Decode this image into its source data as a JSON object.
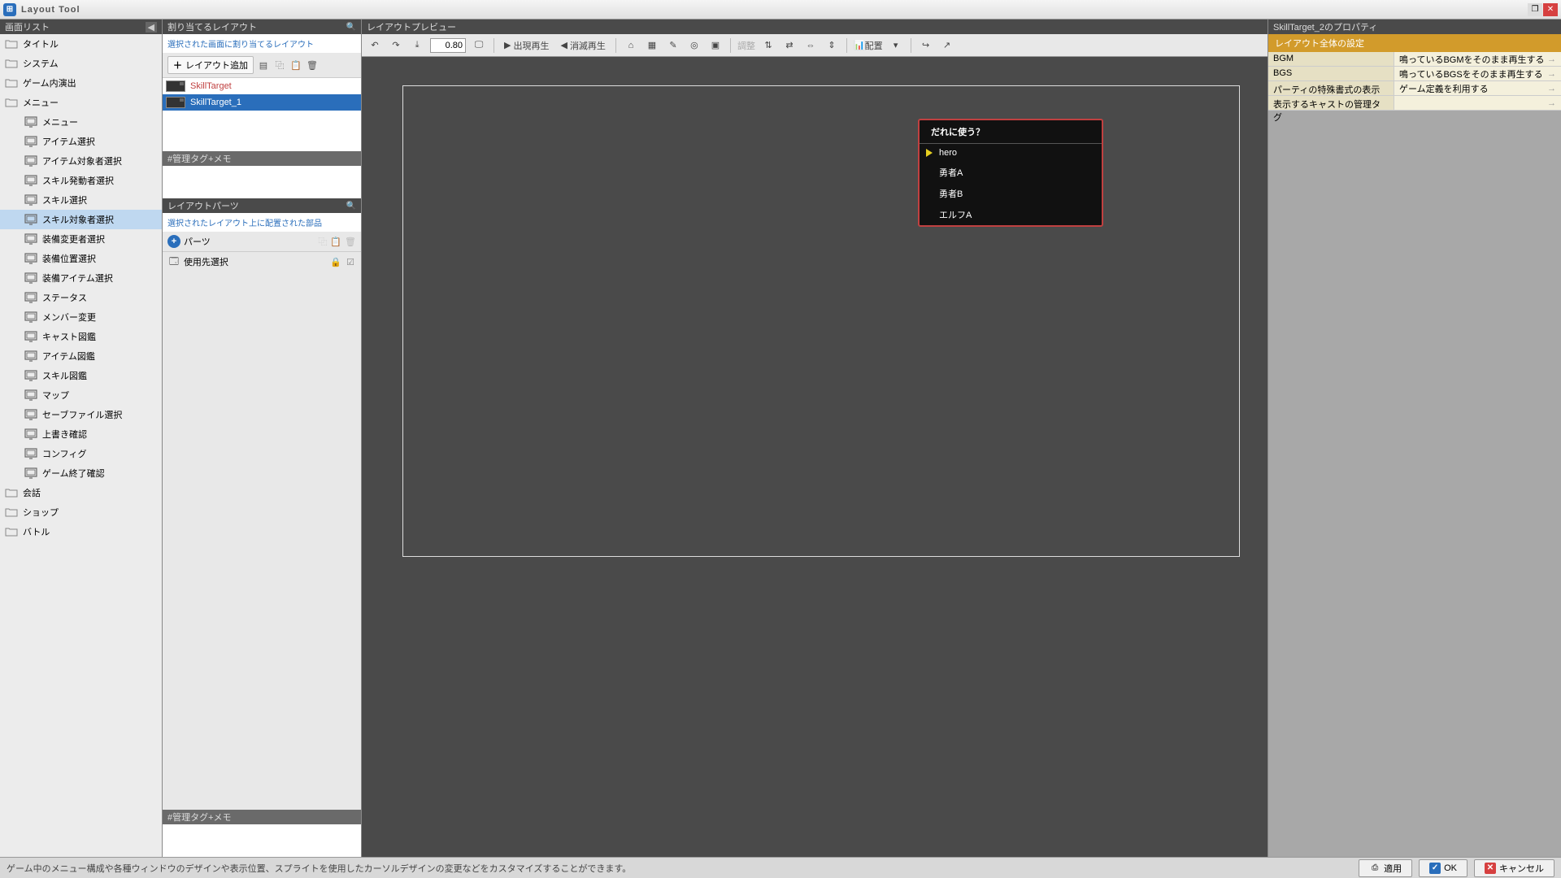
{
  "titlebar": {
    "title": "Layout Tool"
  },
  "leftPanel": {
    "header": "画面リスト"
  },
  "screenTree": [
    {
      "type": "folder",
      "label": "タイトル"
    },
    {
      "type": "folder",
      "label": "システム"
    },
    {
      "type": "folder",
      "label": "ゲーム内演出"
    },
    {
      "type": "folder",
      "label": "メニュー"
    },
    {
      "type": "screen",
      "label": "メニュー"
    },
    {
      "type": "screen",
      "label": "アイテム選択"
    },
    {
      "type": "screen",
      "label": "アイテム対象者選択"
    },
    {
      "type": "screen",
      "label": "スキル発動者選択"
    },
    {
      "type": "screen",
      "label": "スキル選択"
    },
    {
      "type": "screen",
      "label": "スキル対象者選択",
      "selected": true
    },
    {
      "type": "screen",
      "label": "装備変更者選択"
    },
    {
      "type": "screen",
      "label": "装備位置選択"
    },
    {
      "type": "screen",
      "label": "装備アイテム選択"
    },
    {
      "type": "screen",
      "label": "ステータス"
    },
    {
      "type": "screen",
      "label": "メンバー変更"
    },
    {
      "type": "screen",
      "label": "キャスト図鑑"
    },
    {
      "type": "screen",
      "label": "アイテム図鑑"
    },
    {
      "type": "screen",
      "label": "スキル図鑑"
    },
    {
      "type": "screen",
      "label": "マップ"
    },
    {
      "type": "screen",
      "label": "セーブファイル選択"
    },
    {
      "type": "screen",
      "label": "上書き確認"
    },
    {
      "type": "screen",
      "label": "コンフィグ"
    },
    {
      "type": "screen",
      "label": "ゲーム終了確認"
    },
    {
      "type": "folder",
      "label": "会話"
    },
    {
      "type": "folder",
      "label": "ショップ"
    },
    {
      "type": "folder",
      "label": "バトル"
    }
  ],
  "midPanel": {
    "assignHeader": "割り当てるレイアウト",
    "assignHint": "選択された画面に割り当てるレイアウト",
    "addLayoutLabel": "レイアウト追加",
    "layouts": [
      {
        "name": "SkillTarget",
        "selected": false
      },
      {
        "name": "SkillTarget_1",
        "selected": true
      }
    ],
    "memoHeader1": "#管理タグ+メモ",
    "partsHeader": "レイアウトパーツ",
    "partsHint": "選択されたレイアウト上に配置された部品",
    "partsLabel": "パーツ",
    "usageLabel": "使用先選択",
    "memoHeader2": "#管理タグ+メモ"
  },
  "preview": {
    "header": "レイアウトプレビュー",
    "zoom": "0.80",
    "playAppear": "出現再生",
    "playDisappear": "消滅再生",
    "adjustLabel": "調整",
    "arrangeLabel": "配置",
    "gameWindow": {
      "title": "だれに使う？",
      "items": [
        "hero",
        "勇者A",
        "勇者B",
        "エルフA"
      ]
    }
  },
  "rightPanel": {
    "header": "SkillTarget_2のプロパティ",
    "section": "レイアウト全体の設定",
    "rows": [
      {
        "key": "BGM",
        "val": "鳴っているBGMをそのまま再生する",
        "arrow": true
      },
      {
        "key": "BGS",
        "val": "鳴っているBGSをそのまま再生する",
        "arrow": true
      },
      {
        "key": "パーティの特殊書式の表示",
        "val": "ゲーム定義を利用する",
        "arrow": true
      },
      {
        "key": "表示するキャストの管理タグ",
        "val": "",
        "arrow": true
      }
    ]
  },
  "footer": {
    "hint": "ゲーム中のメニュー構成や各種ウィンドウのデザインや表示位置、スプライトを使用したカーソルデザインの変更などをカスタマイズすることができます。",
    "apply": "適用",
    "ok": "OK",
    "cancel": "キャンセル"
  }
}
